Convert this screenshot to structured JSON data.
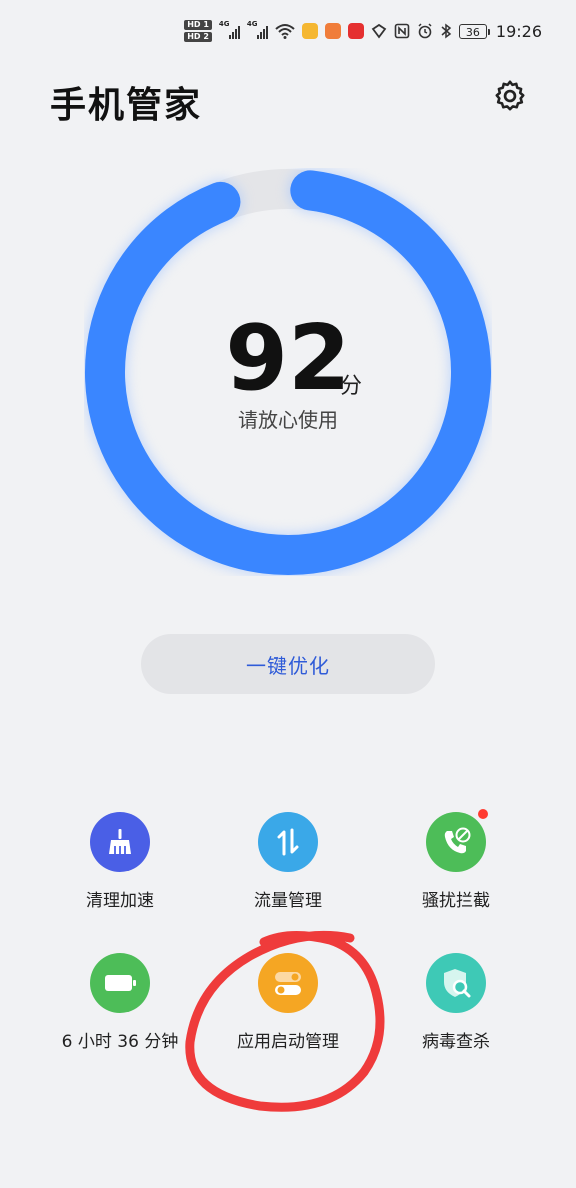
{
  "status_bar": {
    "hd1": "HD 1",
    "hd2": "HD 2",
    "net1": "4G",
    "net2": "4G",
    "battery": "36",
    "time": "19:26",
    "icons": [
      "signal-icon",
      "wifi-icon",
      "notification-app-icon",
      "nfc-icon",
      "alarm-icon",
      "bluetooth-icon",
      "battery-icon"
    ]
  },
  "header": {
    "title": "手机管家",
    "settings_icon": "gear-icon"
  },
  "score": {
    "value": "92",
    "unit": "分",
    "status": "请放心使用",
    "fraction": 0.92,
    "color": "#3a86ff"
  },
  "optimize_button": "一键优化",
  "tools": [
    {
      "label": "清理加速",
      "icon": "broom-icon",
      "color": "#4a5fe6"
    },
    {
      "label": "流量管理",
      "icon": "data-transfer-icon",
      "color": "#3aa8e8"
    },
    {
      "label": "骚扰拦截",
      "icon": "phone-block-icon",
      "color": "#4dbd58",
      "badge": true
    },
    {
      "label": "6 小时 36 分钟",
      "icon": "battery-icon",
      "color": "#4dbd58"
    },
    {
      "label": "应用启动管理",
      "icon": "toggle-switch-icon",
      "color": "#f5a623"
    },
    {
      "label": "病毒查杀",
      "icon": "shield-search-icon",
      "color": "#3ec9b6"
    }
  ],
  "annotation_color": "#ef3b3b"
}
